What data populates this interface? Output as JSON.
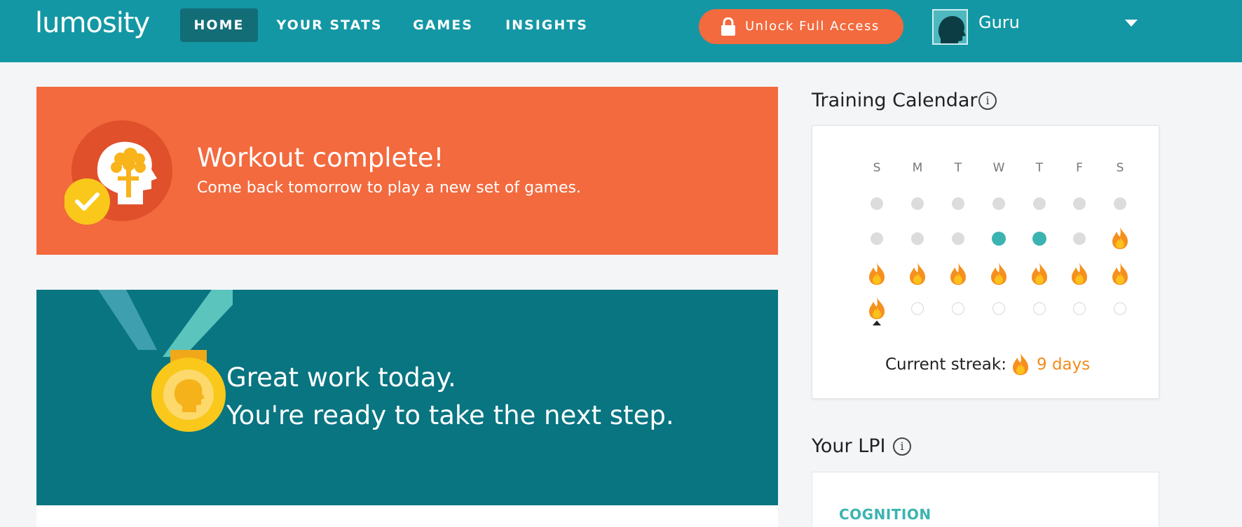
{
  "header": {
    "logo": "lumosity",
    "nav": [
      {
        "label": "HOME",
        "active": true
      },
      {
        "label": "YOUR STATS",
        "active": false
      },
      {
        "label": "GAMES",
        "active": false
      },
      {
        "label": "INSIGHTS",
        "active": false
      }
    ],
    "unlock_label": "Unlock Full Access",
    "user_name": "Guru"
  },
  "workout": {
    "title": "Workout complete!",
    "subtitle": "Come back tomorrow to play a new set of games."
  },
  "great": {
    "line1": "Great work today.",
    "line2": "You're ready to take the next step."
  },
  "calendar": {
    "title": "Training Calendar",
    "days": [
      "S",
      "M",
      "T",
      "W",
      "T",
      "F",
      "S"
    ],
    "weeks": [
      [
        "past",
        "past",
        "past",
        "past",
        "past",
        "past",
        "past"
      ],
      [
        "past",
        "past",
        "past",
        "played",
        "played",
        "past",
        "streak"
      ],
      [
        "streak",
        "streak",
        "streak",
        "streak",
        "streak",
        "streak",
        "streak"
      ],
      [
        "streak",
        "future",
        "future",
        "future",
        "future",
        "future",
        "future"
      ]
    ],
    "streak_label": "Current streak:",
    "streak_value": "9 days"
  },
  "lpi": {
    "title": "Your LPI",
    "category": "COGNITION"
  },
  "colors": {
    "nav_bg": "#1497a4",
    "nav_active": "#126d77",
    "orange": "#f26a3e",
    "teal_card": "#087581",
    "teal_dot": "#3bb4b1",
    "streak_text": "#f28b1c"
  }
}
